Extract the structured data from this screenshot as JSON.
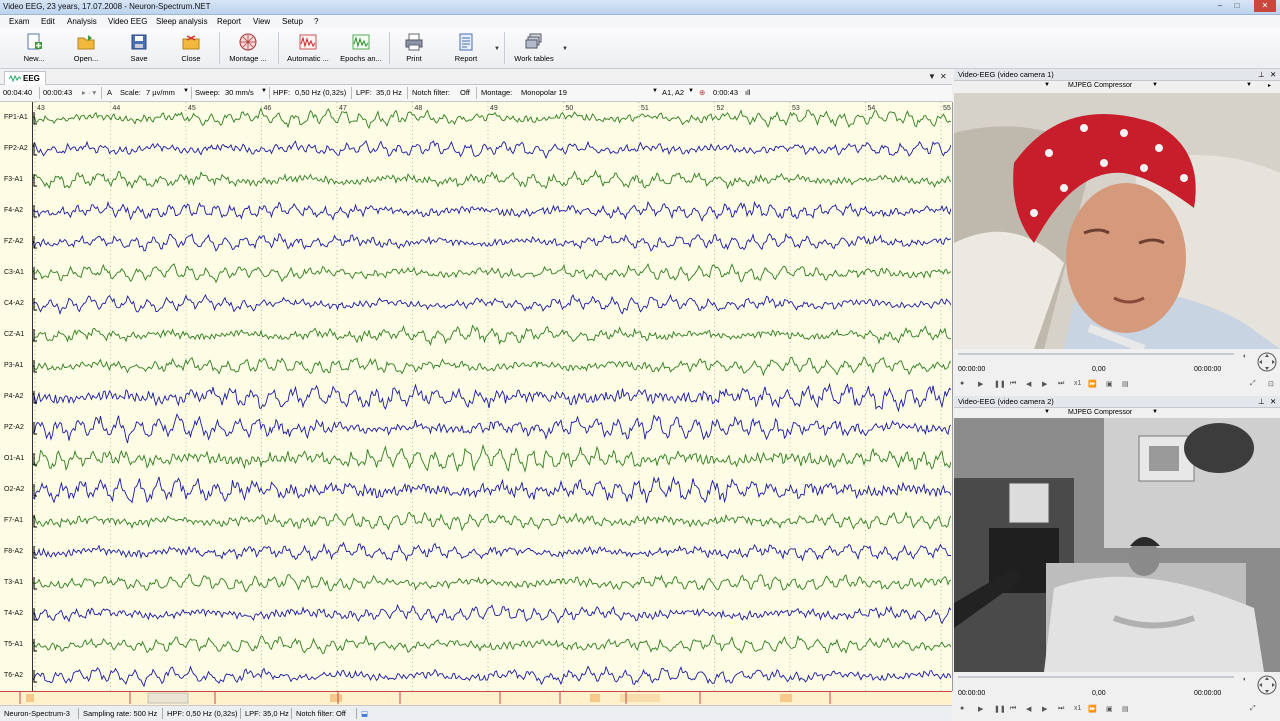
{
  "window": {
    "title": "Video EEG, 23 years, 17.07.2008 - Neuron-Spectrum.NET",
    "controls": [
      "–",
      "□",
      "✕"
    ]
  },
  "menu": [
    "Exam",
    "Edit",
    "Analysis",
    "Video EEG",
    "Sleep analysis",
    "Report",
    "View",
    "Setup",
    "?"
  ],
  "toolbar": {
    "buttons": [
      {
        "label": "New...",
        "icon": "new-document-icon"
      },
      {
        "label": "Open...",
        "icon": "open-folder-icon"
      },
      {
        "label": "Save",
        "icon": "save-disk-icon"
      },
      {
        "label": "Close",
        "icon": "close-folder-icon"
      },
      {
        "label": "Montage ...",
        "icon": "montage-head-icon"
      },
      {
        "label": "Automatic ...",
        "icon": "automatic-analysis-icon"
      },
      {
        "label": "Epochs an...",
        "icon": "epochs-analysis-icon"
      },
      {
        "label": "Print",
        "icon": "printer-icon"
      },
      {
        "label": "Report",
        "icon": "report-icon"
      },
      {
        "label": "Work tables",
        "icon": "work-tables-icon"
      }
    ]
  },
  "doc_tab": {
    "label": "EEG"
  },
  "eeg_toolbar": {
    "time_position": "00:04:40",
    "time_window": "00:00:43",
    "font_label": "A",
    "scale_label": "Scale:",
    "scale_value": "7 µv/mm",
    "sweep_label": "Sweep:",
    "sweep_value": "30 mm/s",
    "hpf_label": "HPF:",
    "hpf_value": "0,50 Hz (0,32s)",
    "lpf_label": "LPF:",
    "lpf_value": "35,0 Hz",
    "notch_label": "Notch filter:",
    "notch_value": "Off",
    "montage_label": "Montage:",
    "montage_value": "Monopolar 19",
    "reference": "A1, A2",
    "clock_value": "0:00:43",
    "extra": "ıll"
  },
  "eeg": {
    "second_ticks": [
      "43",
      "44",
      "45",
      "46",
      "47",
      "48",
      "49",
      "50",
      "51",
      "52",
      "53",
      "54",
      "55"
    ],
    "channels": [
      {
        "label": "FP1-A1",
        "color": "#2e7d1f"
      },
      {
        "label": "FP2-A2",
        "color": "#1a1aa0"
      },
      {
        "label": "F3-A1",
        "color": "#2e7d1f"
      },
      {
        "label": "F4-A2",
        "color": "#1a1aa0"
      },
      {
        "label": "FZ-A2",
        "color": "#1a1aa0"
      },
      {
        "label": "C3-A1",
        "color": "#2e7d1f"
      },
      {
        "label": "C4-A2",
        "color": "#1a1aa0"
      },
      {
        "label": "CZ-A1",
        "color": "#2e7d1f"
      },
      {
        "label": "P3-A1",
        "color": "#2e7d1f"
      },
      {
        "label": "P4-A2",
        "color": "#1a1aa0"
      },
      {
        "label": "PZ-A2",
        "color": "#1a1aa0"
      },
      {
        "label": "O1-A1",
        "color": "#2e7d1f"
      },
      {
        "label": "O2-A2",
        "color": "#1a1aa0"
      },
      {
        "label": "F7-A1",
        "color": "#2e7d1f"
      },
      {
        "label": "F8-A2",
        "color": "#1a1aa0"
      },
      {
        "label": "T3-A1",
        "color": "#2e7d1f"
      },
      {
        "label": "T4-A2",
        "color": "#1a1aa0"
      },
      {
        "label": "T5-A1",
        "color": "#2e7d1f"
      },
      {
        "label": "T6-A2",
        "color": "#1a1aa0"
      }
    ]
  },
  "status": {
    "device": "Neuron-Spectrum-3",
    "sampling": "Sampling rate: 500 Hz",
    "hpf": "HPF: 0,50 Hz (0,32s)",
    "lpf": "LPF: 35,0 Hz",
    "notch": "Notch filter: Off"
  },
  "video1": {
    "title": "Video-EEG (video camera 1)",
    "codec": "MJPEG Compressor",
    "time_start": "00:00:00",
    "time_mid": "0,00",
    "time_end": "00:00:00",
    "speed": "x1"
  },
  "video2": {
    "title": "Video-EEG (video camera 2)",
    "codec": "MJPEG Compressor",
    "time_start": "00:00:00",
    "time_mid": "0,00",
    "time_end": "00:00:00",
    "speed": "x1"
  }
}
